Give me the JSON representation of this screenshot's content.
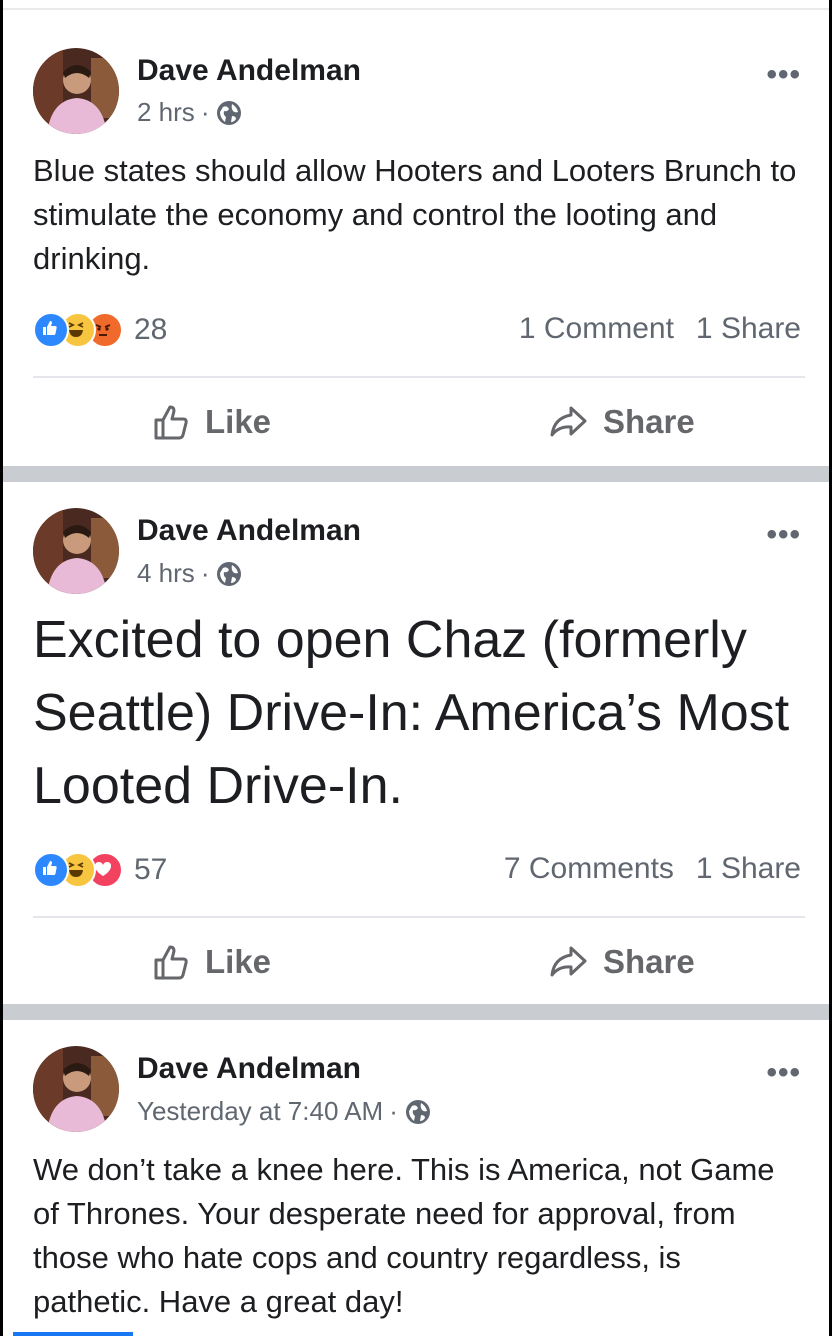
{
  "posts": [
    {
      "author": "Dave Andelman",
      "time": "2 hrs",
      "text": "Blue states should allow Hooters and Looters Brunch to stimulate the economy and control the looting and drinking.",
      "reactions_count": "28",
      "reaction_icons": [
        "like",
        "haha",
        "angry"
      ],
      "comments": "1 Comment",
      "shares": "1 Share",
      "like_label": "Like",
      "share_label": "Share"
    },
    {
      "author": "Dave Andelman",
      "time": "4 hrs",
      "text": "Excited to open Chaz (formerly Seattle) Drive-In:  America’s Most Looted Drive-In.",
      "reactions_count": "57",
      "reaction_icons": [
        "like",
        "haha",
        "love"
      ],
      "comments": "7 Comments",
      "shares": "1 Share",
      "like_label": "Like",
      "share_label": "Share"
    },
    {
      "author": "Dave Andelman",
      "time": "Yesterday at 7:40 AM",
      "text": "We don’t take a knee here.  This is America, not Game of Thrones.  Your desperate need for approval, from those who hate cops and country regardless, is pathetic.  Have a great day!"
    }
  ],
  "separator": "·",
  "more_glyph": "•••",
  "colors": {
    "like_blue": "#2d88ff",
    "haha_yellow": "#f7c540",
    "angry_orange": "#f06b2b",
    "love_red": "#f3425f",
    "divider_gray": "#c9ccd1"
  }
}
